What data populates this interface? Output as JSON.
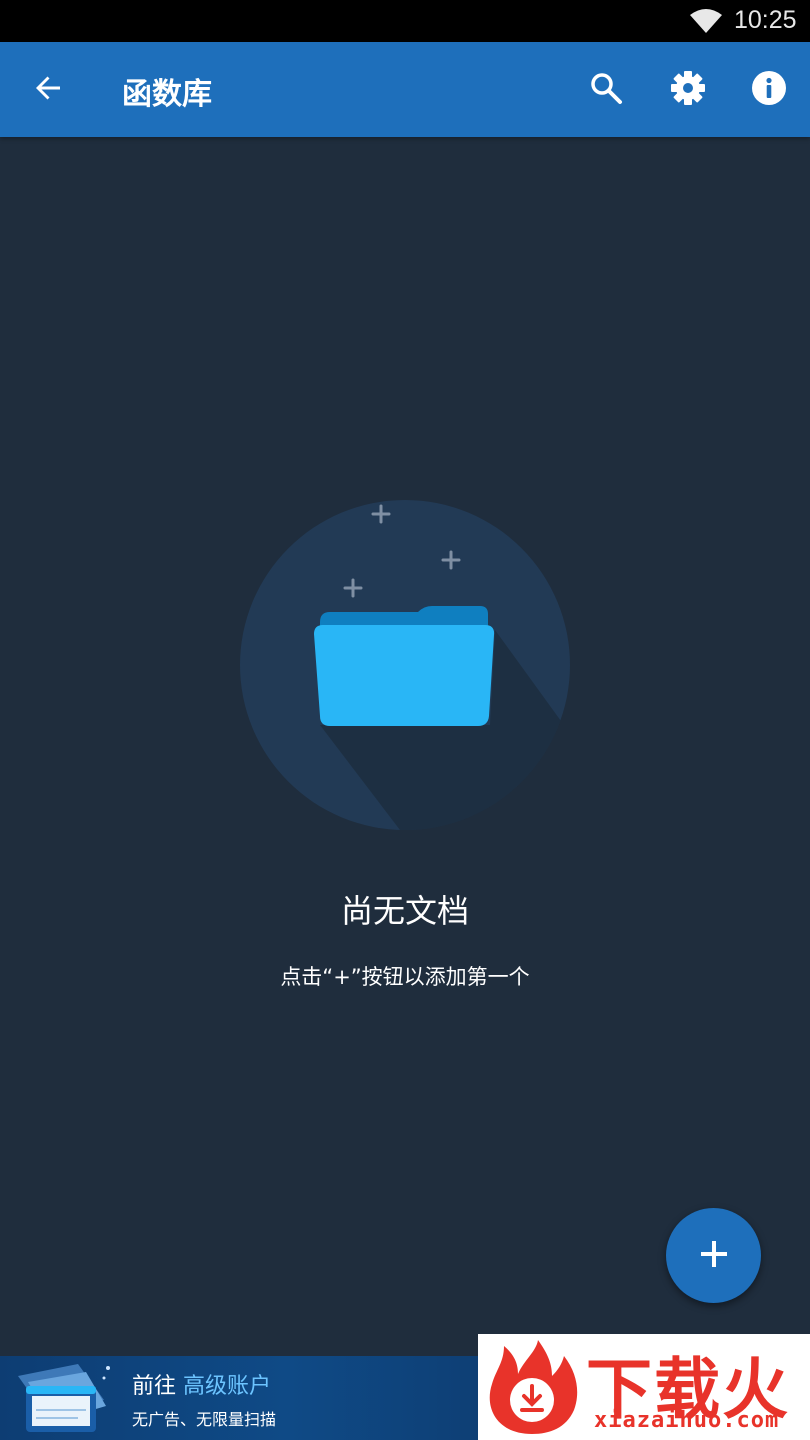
{
  "status_bar": {
    "time": "10:25",
    "wifi_icon": "wifi-icon"
  },
  "app_bar": {
    "title": "函数库",
    "back_icon": "arrow-back-icon",
    "actions": [
      "search-icon",
      "gear-icon",
      "info-icon"
    ],
    "color": "#1e6fbb"
  },
  "empty_state": {
    "title": "尚无文档",
    "hint": "点击“+”按钮以添加第一个",
    "illustration_icon": "folder-icon",
    "folder_color": "#29b6f6"
  },
  "fab": {
    "icon": "plus-icon",
    "color": "#1e6fbb"
  },
  "promo": {
    "prefix": "前往",
    "highlight": "高级账户",
    "subtitle": "无广告、无限量扫描",
    "highlight_color": "#6cc4ff"
  },
  "watermark": {
    "brand": "下载火",
    "url": "xiazaihuo.com",
    "color": "#e8332a"
  },
  "colors": {
    "background": "#1f2d3d"
  }
}
